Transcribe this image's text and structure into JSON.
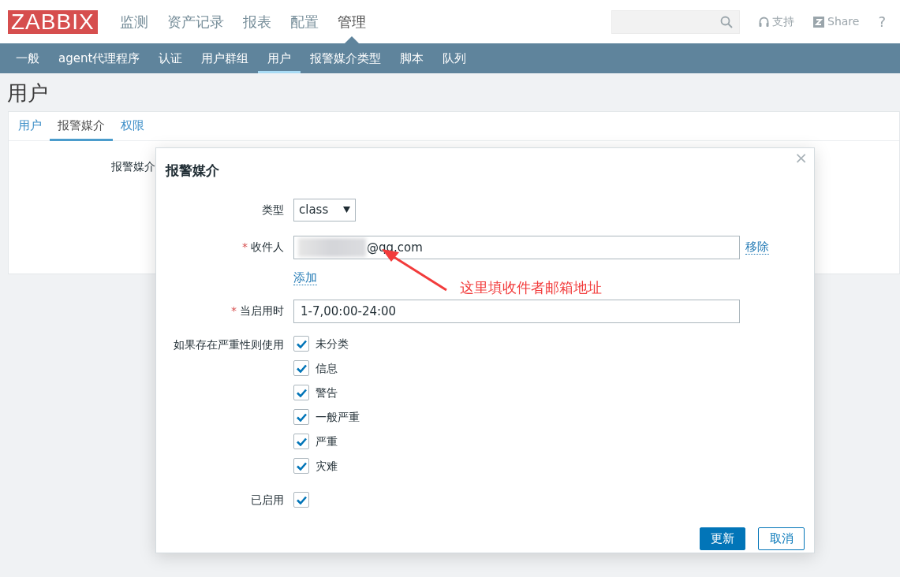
{
  "header": {
    "logo": "ZABBIX",
    "menu": [
      {
        "label": "监测",
        "selected": false
      },
      {
        "label": "资产记录",
        "selected": false
      },
      {
        "label": "报表",
        "selected": false
      },
      {
        "label": "配置",
        "selected": false
      },
      {
        "label": "管理",
        "selected": true
      }
    ],
    "links": [
      {
        "kind": "support",
        "label": "支持"
      },
      {
        "kind": "share",
        "label": "Share"
      },
      {
        "kind": "help",
        "label": "?"
      }
    ]
  },
  "submenu": [
    {
      "label": "一般",
      "selected": false
    },
    {
      "label": "agent代理程序",
      "selected": false
    },
    {
      "label": "认证",
      "selected": false
    },
    {
      "label": "用户群组",
      "selected": false
    },
    {
      "label": "用户",
      "selected": true
    },
    {
      "label": "报警媒介类型",
      "selected": false
    },
    {
      "label": "脚本",
      "selected": false
    },
    {
      "label": "队列",
      "selected": false
    }
  ],
  "page_title": "用户",
  "tabs": [
    {
      "label": "用户",
      "selected": false
    },
    {
      "label": "报警媒介",
      "selected": true
    },
    {
      "label": "权限",
      "selected": false
    }
  ],
  "background_form": {
    "label": "报警媒介"
  },
  "dialog": {
    "title": "报警媒介",
    "close": "×",
    "type": {
      "label": "类型",
      "value": "class"
    },
    "recipient": {
      "required_mark": "*",
      "label": "收件人",
      "value": "@qq.com",
      "remove": "移除",
      "add": "添加"
    },
    "period": {
      "required_mark": "*",
      "label": "当启用时",
      "value": "1-7,00:00-24:00"
    },
    "severity": {
      "label": "如果存在严重性则使用",
      "options": [
        {
          "label": "未分类",
          "checked": true
        },
        {
          "label": "信息",
          "checked": true
        },
        {
          "label": "警告",
          "checked": true
        },
        {
          "label": "一般严重",
          "checked": true
        },
        {
          "label": "严重",
          "checked": true
        },
        {
          "label": "灾难",
          "checked": true
        }
      ]
    },
    "enabled": {
      "label": "已启用",
      "checked": true
    },
    "buttons": [
      {
        "label": "更新",
        "kind": "primary"
      },
      {
        "label": "取消",
        "kind": "secondary"
      }
    ]
  },
  "annotation": {
    "text": "这里填收件者邮箱地址"
  }
}
